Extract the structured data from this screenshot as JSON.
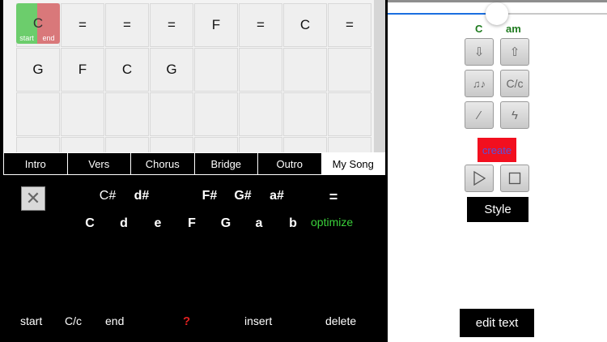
{
  "grid": {
    "row1": [
      "C",
      "=",
      "=",
      "=",
      "F",
      "=",
      "C",
      "="
    ],
    "row2": [
      "G",
      "F",
      "C",
      "G",
      "",
      "",
      "",
      ""
    ],
    "start_tag": "start",
    "end_tag": "end"
  },
  "tabs": [
    "Intro",
    "Vers",
    "Chorus",
    "Bridge",
    "Outro",
    "My Song"
  ],
  "active_tab": "My Song",
  "keys": {
    "sharps": [
      "C#",
      "d#",
      "F#",
      "G#",
      "a#",
      "="
    ],
    "naturals": [
      "C",
      "d",
      "e",
      "F",
      "G",
      "a",
      "b"
    ],
    "optimize": "optimize"
  },
  "actions": {
    "start": "start",
    "cc": "C/c",
    "end": "end",
    "help": "?",
    "insert": "insert",
    "delete": "delete"
  },
  "right": {
    "key_major": "C",
    "key_minor": "am",
    "cc_label": "C/c",
    "create": "create",
    "style": "Style",
    "edit_text": "edit text"
  },
  "slider": {
    "value_fraction": 0.49
  },
  "colors": {
    "start": "#6ccd6c",
    "end": "#d9787a",
    "optimize": "#3ad13a",
    "key_labels": "#1e7a1e",
    "create_bg": "#f20f1f",
    "slider_fill": "#1b6fe0"
  }
}
